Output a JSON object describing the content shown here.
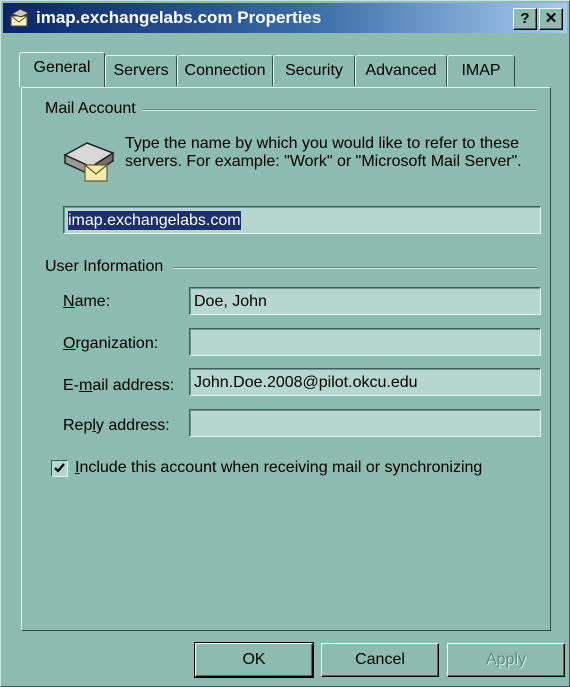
{
  "window": {
    "title": "imap.exchangelabs.com Properties"
  },
  "title_buttons": {
    "help": "?",
    "close": "✕"
  },
  "tabs": [
    {
      "label": "General",
      "active": true
    },
    {
      "label": "Servers"
    },
    {
      "label": "Connection"
    },
    {
      "label": "Security"
    },
    {
      "label": "Advanced"
    },
    {
      "label": "IMAP"
    }
  ],
  "mail_account": {
    "group_label": "Mail Account",
    "description": "Type the name by which you would like to refer to these servers.  For example: \"Work\" or \"Microsoft Mail Server\".",
    "account_name": "imap.exchangelabs.com",
    "icon": "mail-server-icon"
  },
  "user_information": {
    "group_label": "User Information",
    "fields": [
      {
        "label": "Name:",
        "value": "Doe, John"
      },
      {
        "label": "Organization:",
        "value": ""
      },
      {
        "label": "E-mail address:",
        "value": "John.Doe.2008@pilot.okcu.edu"
      },
      {
        "label": "Reply address:",
        "value": ""
      }
    ]
  },
  "include_checkbox": {
    "checked": true,
    "label": "Include this account when receiving mail or synchronizing"
  },
  "buttons": {
    "ok": "OK",
    "cancel": "Cancel",
    "apply": "Apply"
  }
}
